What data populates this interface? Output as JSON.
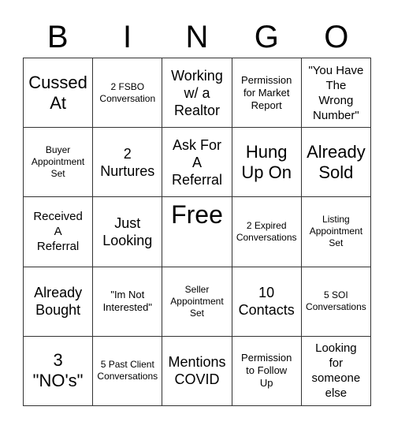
{
  "header": {
    "letters": [
      "B",
      "I",
      "N",
      "G",
      "O"
    ]
  },
  "card": {
    "rows": [
      [
        {
          "text": "Cussed\nAt",
          "size": "l"
        },
        {
          "text": "2 FSBO\nConversation",
          "size": "s"
        },
        {
          "text": "Working\nw/ a\nRealtor",
          "size": "m"
        },
        {
          "text": "Permission\nfor Market\nReport",
          "size": "sm"
        },
        {
          "text": "\"You Have\nThe\nWrong\nNumber\"",
          "size": "ms"
        }
      ],
      [
        {
          "text": "Buyer\nAppointment\nSet",
          "size": "s"
        },
        {
          "text": "2\nNurtures",
          "size": "m"
        },
        {
          "text": "Ask For\nA\nReferral",
          "size": "m"
        },
        {
          "text": "Hung\nUp On",
          "size": "l"
        },
        {
          "text": "Already\nSold",
          "size": "l"
        }
      ],
      [
        {
          "text": "Received\nA\nReferral",
          "size": "ms"
        },
        {
          "text": "Just\nLooking",
          "size": "m"
        },
        {
          "text": "Free",
          "size": "xl"
        },
        {
          "text": "2 Expired\nConversations",
          "size": "s"
        },
        {
          "text": "Listing\nAppointment\nSet",
          "size": "s"
        }
      ],
      [
        {
          "text": "Already\nBought",
          "size": "m"
        },
        {
          "text": "\"Im Not\nInterested\"",
          "size": "sm"
        },
        {
          "text": "Seller\nAppointment\nSet",
          "size": "s"
        },
        {
          "text": "10\nContacts",
          "size": "m"
        },
        {
          "text": "5 SOI\nConversations",
          "size": "s"
        }
      ],
      [
        {
          "text": "3\n\"NO's\"",
          "size": "l"
        },
        {
          "text": "5 Past Client\nConversations",
          "size": "s"
        },
        {
          "text": "Mentions\nCOVID",
          "size": "m"
        },
        {
          "text": "Permission\nto Follow\nUp",
          "size": "sm"
        },
        {
          "text": "Looking\nfor\nsomeone\nelse",
          "size": "ms"
        }
      ]
    ]
  }
}
